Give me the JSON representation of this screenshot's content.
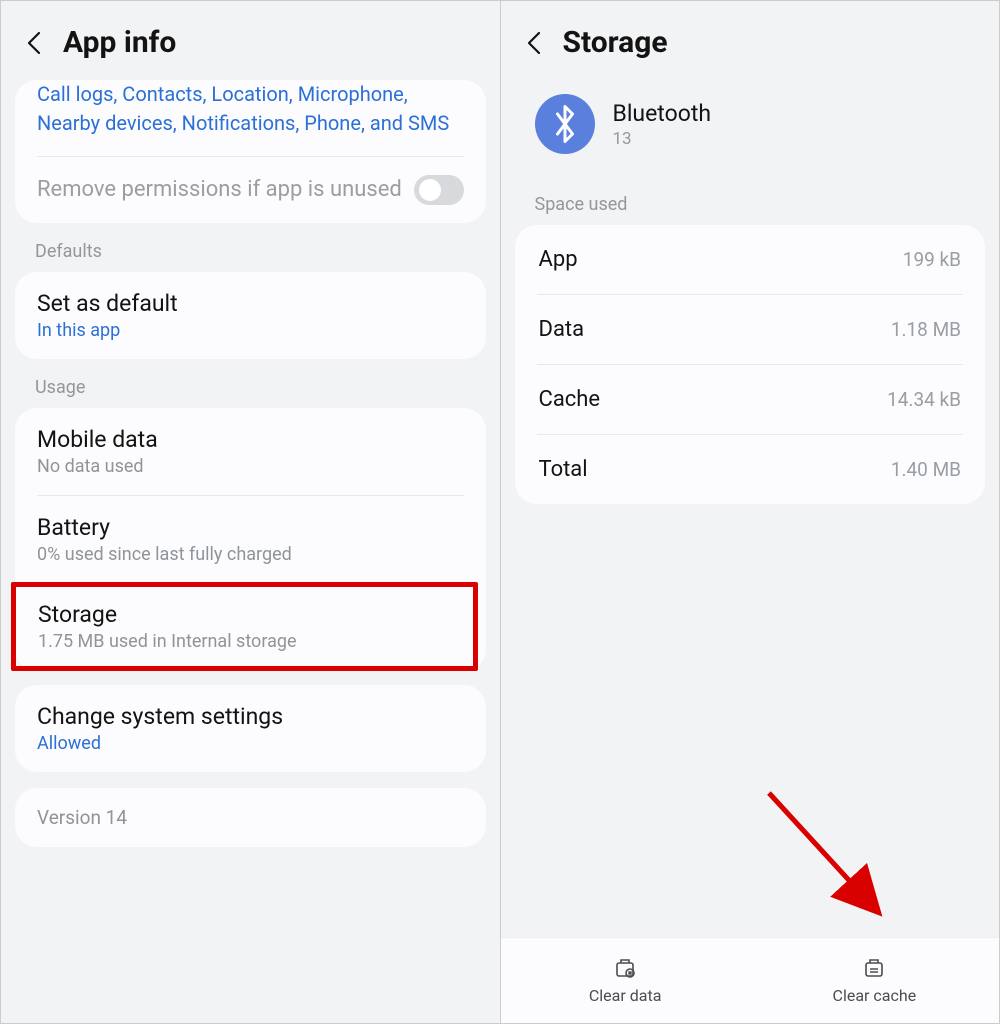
{
  "left": {
    "title": "App info",
    "permissions_text": "Call logs, Contacts, Location, Microphone, Nearby devices, Notifications, Phone, and SMS",
    "remove_perms": "Remove permissions if app is unused",
    "defaults_label": "Defaults",
    "set_default": {
      "title": "Set as default",
      "sub": "In this app"
    },
    "usage_label": "Usage",
    "mobile_data": {
      "title": "Mobile data",
      "sub": "No data used"
    },
    "battery": {
      "title": "Battery",
      "sub": "0% used since last fully charged"
    },
    "storage": {
      "title": "Storage",
      "sub": "1.75 MB used in Internal storage"
    },
    "change_settings": {
      "title": "Change system settings",
      "sub": "Allowed"
    },
    "version": "Version 14"
  },
  "right": {
    "title": "Storage",
    "app": {
      "name": "Bluetooth",
      "version": "13"
    },
    "space_used_label": "Space used",
    "rows": {
      "app": {
        "label": "App",
        "value": "199 kB"
      },
      "data": {
        "label": "Data",
        "value": "1.18 MB"
      },
      "cache": {
        "label": "Cache",
        "value": "14.34 kB"
      },
      "total": {
        "label": "Total",
        "value": "1.40 MB"
      }
    },
    "buttons": {
      "clear_data": "Clear data",
      "clear_cache": "Clear cache"
    }
  }
}
